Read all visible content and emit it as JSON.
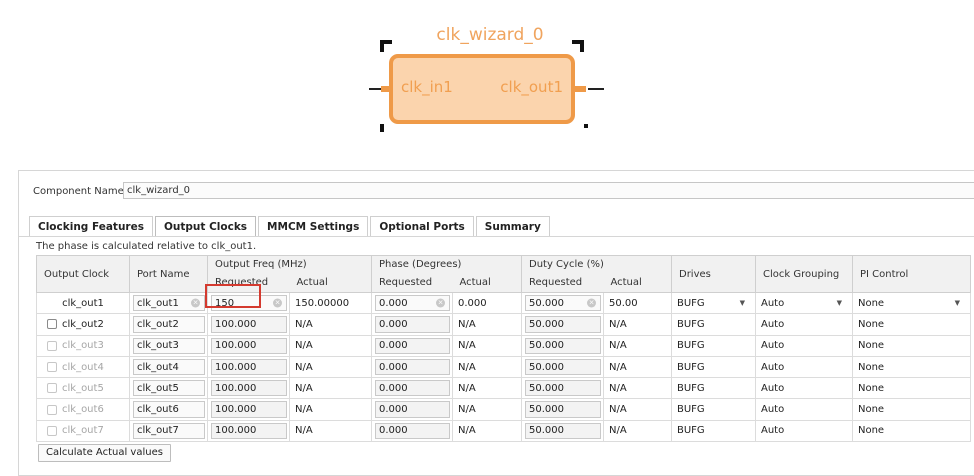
{
  "diagram": {
    "ip_name": "clk_wizard_0",
    "input_pin": "clk_in1",
    "output_pin": "clk_out1"
  },
  "component": {
    "label": "Component Name",
    "value": "clk_wizard_0"
  },
  "tabs": [
    "Clocking Features",
    "Output Clocks",
    "MMCM Settings",
    "Optional Ports",
    "Summary"
  ],
  "active_tab": "Output Clocks",
  "note": "The phase is calculated relative to clk_out1.",
  "table": {
    "headers": {
      "output_clock": "Output Clock",
      "port_name": "Port Name",
      "freq_group": "Output Freq (MHz)",
      "phase_group": "Phase (Degrees)",
      "duty_group": "Duty Cycle (%)",
      "requested": "Requested",
      "actual": "Actual",
      "drives": "Drives",
      "clock_grouping": "Clock Grouping",
      "pi_control": "PI Control"
    },
    "rows": [
      {
        "clock": "clk_out1",
        "port": "clk_out1",
        "freq_req": "150",
        "freq_act": "150.00000",
        "phase_req": "0.000",
        "phase_act": "0.000",
        "duty_req": "50.000",
        "duty_act": "50.00",
        "drives": "BUFG",
        "grouping": "Auto",
        "pi": "None"
      },
      {
        "clock": "clk_out2",
        "port": "clk_out2",
        "freq_req": "100.000",
        "freq_act": "N/A",
        "phase_req": "0.000",
        "phase_act": "N/A",
        "duty_req": "50.000",
        "duty_act": "N/A",
        "drives": "BUFG",
        "grouping": "Auto",
        "pi": "None"
      },
      {
        "clock": "clk_out3",
        "port": "clk_out3",
        "freq_req": "100.000",
        "freq_act": "N/A",
        "phase_req": "0.000",
        "phase_act": "N/A",
        "duty_req": "50.000",
        "duty_act": "N/A",
        "drives": "BUFG",
        "grouping": "Auto",
        "pi": "None"
      },
      {
        "clock": "clk_out4",
        "port": "clk_out4",
        "freq_req": "100.000",
        "freq_act": "N/A",
        "phase_req": "0.000",
        "phase_act": "N/A",
        "duty_req": "50.000",
        "duty_act": "N/A",
        "drives": "BUFG",
        "grouping": "Auto",
        "pi": "None"
      },
      {
        "clock": "clk_out5",
        "port": "clk_out5",
        "freq_req": "100.000",
        "freq_act": "N/A",
        "phase_req": "0.000",
        "phase_act": "N/A",
        "duty_req": "50.000",
        "duty_act": "N/A",
        "drives": "BUFG",
        "grouping": "Auto",
        "pi": "None"
      },
      {
        "clock": "clk_out6",
        "port": "clk_out6",
        "freq_req": "100.000",
        "freq_act": "N/A",
        "phase_req": "0.000",
        "phase_act": "N/A",
        "duty_req": "50.000",
        "duty_act": "N/A",
        "drives": "BUFG",
        "grouping": "Auto",
        "pi": "None"
      },
      {
        "clock": "clk_out7",
        "port": "clk_out7",
        "freq_req": "100.000",
        "freq_act": "N/A",
        "phase_req": "0.000",
        "phase_act": "N/A",
        "duty_req": "50.000",
        "duty_act": "N/A",
        "drives": "BUFG",
        "grouping": "Auto",
        "pi": "None"
      }
    ]
  },
  "calc_button": "Calculate Actual values",
  "colors": {
    "ip_fill": "#fbd4ad",
    "ip_border": "#ef9a48",
    "highlight": "#d43a2f"
  },
  "icons": {
    "clear": "clear-circle-icon",
    "dropdown": "dropdown-arrow-icon",
    "checkbox": "checkbox-icon"
  }
}
